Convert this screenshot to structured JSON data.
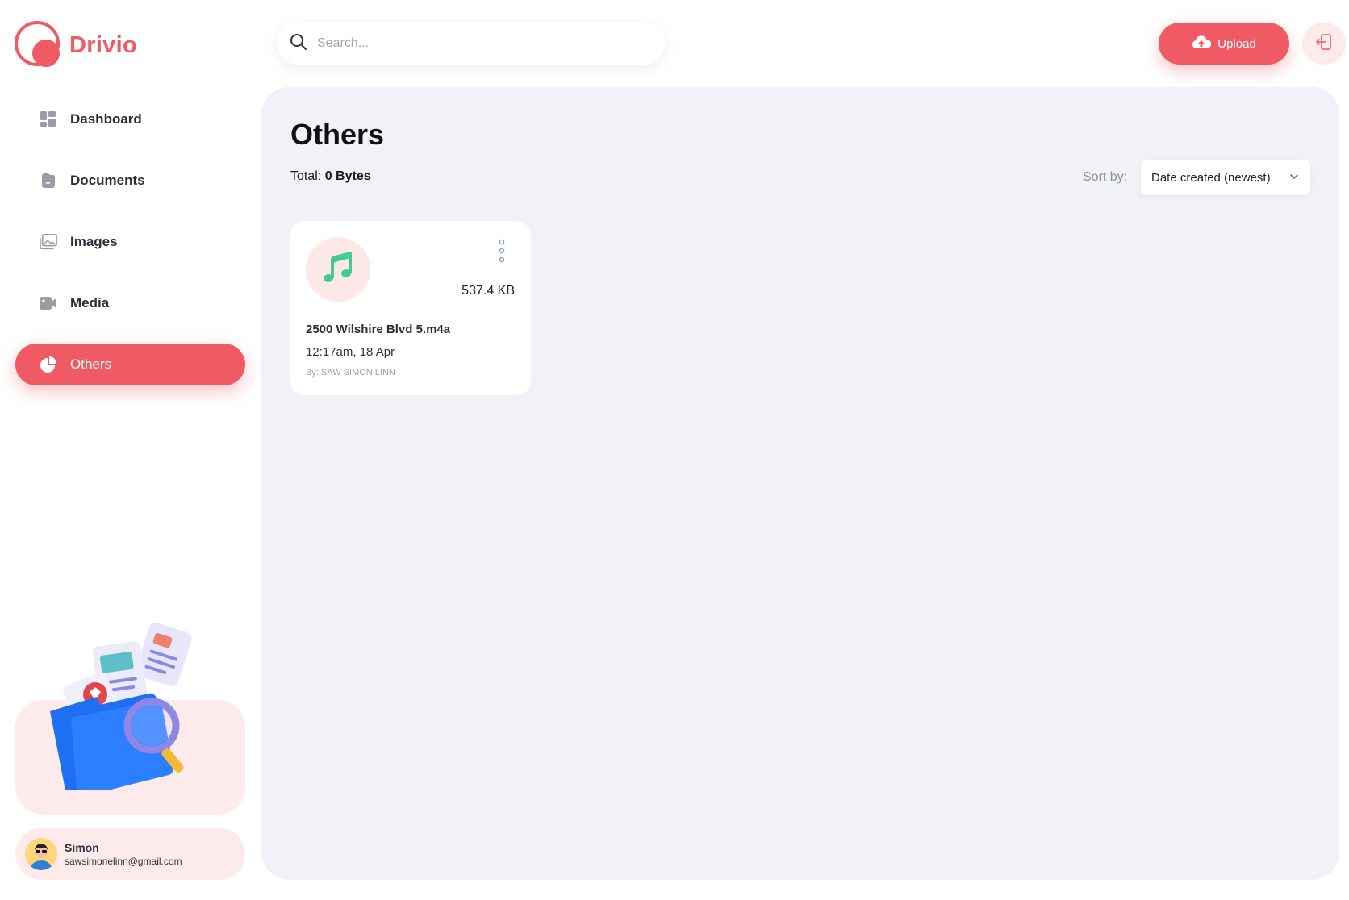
{
  "brand": {
    "name": "Drivio",
    "color": "#f05a65"
  },
  "search": {
    "placeholder": "Search..."
  },
  "header": {
    "upload_label": "Upload"
  },
  "sidebar": {
    "items": [
      {
        "label": "Dashboard",
        "icon": "dashboard-icon",
        "active": false
      },
      {
        "label": "Documents",
        "icon": "documents-icon",
        "active": false
      },
      {
        "label": "Images",
        "icon": "images-icon",
        "active": false
      },
      {
        "label": "Media",
        "icon": "media-icon",
        "active": false
      },
      {
        "label": "Others",
        "icon": "pie-chart-icon",
        "active": true
      }
    ],
    "user": {
      "name": "Simon",
      "email": "sawsimonelinn@gmail.com"
    }
  },
  "main": {
    "title": "Others",
    "total_label": "Total:",
    "total_value": "0 Bytes",
    "sort_label": "Sort by:",
    "sort_value": "Date created (newest)",
    "files": [
      {
        "name": "2500 Wilshire Blvd 5.m4a",
        "size": "537.4 KB",
        "date": "12:17am, 18 Apr",
        "owner": "By: SAW SIMON LINN",
        "icon": "music-note-icon"
      }
    ]
  },
  "colors": {
    "accent": "#f05a65",
    "accent_soft": "#fdeaea",
    "panel_bg": "#f1f2f7",
    "music_icon": "#3ecf8e"
  }
}
